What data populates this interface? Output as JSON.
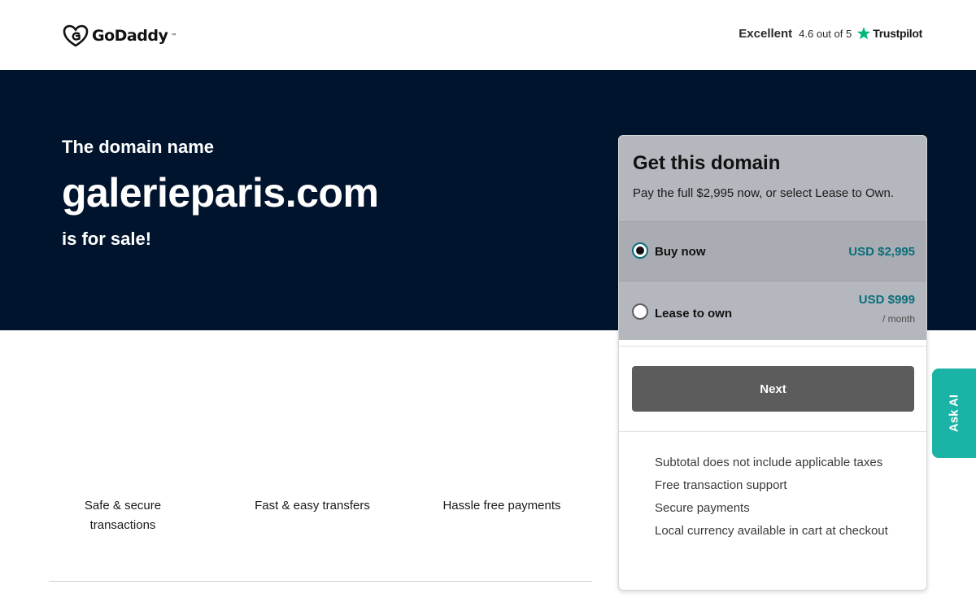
{
  "header": {
    "logo_text": "GoDaddy",
    "rating_word": "Excellent",
    "rating_score": "4.6 out of 5",
    "trustpilot_label": "Trustpilot",
    "trustpilot_color": "#00b67a"
  },
  "hero": {
    "kicker": "The domain name",
    "domain": "galerieparis.com",
    "sale_text": "is for sale!"
  },
  "features": [
    {
      "label": "Safe & secure transactions"
    },
    {
      "label": "Fast & easy transfers"
    },
    {
      "label": "Hassle free payments"
    }
  ],
  "card": {
    "title": "Get this domain",
    "subtitle": "Pay the full $2,995 now, or select Lease to Own.",
    "options": [
      {
        "label": "Buy now",
        "price": "USD $2,995",
        "per": "",
        "selected": true
      },
      {
        "label": "Lease to own",
        "price": "USD $999",
        "per": "/ month",
        "selected": false
      }
    ],
    "next_label": "Next",
    "notes": [
      "Subtotal does not include applicable taxes",
      "Free transaction support",
      "Secure payments",
      "Local currency available in cart at checkout"
    ]
  },
  "ask_ai": {
    "label": "Ask AI"
  },
  "colors": {
    "hero_bg": "#00142d",
    "accent_teal": "#0a6e7b",
    "ask_ai_bg": "#1bb3a6",
    "next_btn_bg": "#5c5c5c"
  }
}
